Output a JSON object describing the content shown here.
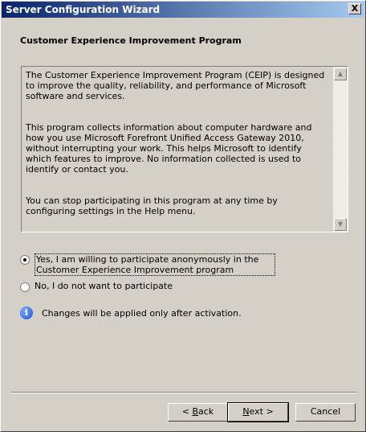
{
  "window": {
    "title": "Server Configuration Wizard",
    "close_label": "X"
  },
  "page": {
    "heading": "Customer Experience Improvement Program"
  },
  "textbox": {
    "paragraphs": [
      "The Customer Experience Improvement Program (CEIP) is designed to improve the quality, reliability, and performance of Microsoft software and services.",
      "This program collects information about computer hardware and how you use Microsoft Forefront Unified Access Gateway 2010, without interrupting your work.  This helps Microsoft to identify which features to improve.  No information collected is used to identify or contact you.",
      "You can stop participating in this program at any time by configuring settings in the Help menu."
    ],
    "scroll_up_glyph": "▲",
    "scroll_down_glyph": "▼"
  },
  "options": [
    {
      "label": "Yes, I am willing to participate anonymously in the Customer Experience Improvement program",
      "checked": true
    },
    {
      "label": "No, I do not want to participate",
      "checked": false
    }
  ],
  "info": {
    "icon": "info-icon",
    "glyph": "i",
    "text": "Changes will be applied only after activation."
  },
  "buttons": {
    "back_prefix": "< ",
    "back_access": "B",
    "back_rest": "ack",
    "next_access": "N",
    "next_rest": "ext >",
    "cancel": "Cancel"
  }
}
